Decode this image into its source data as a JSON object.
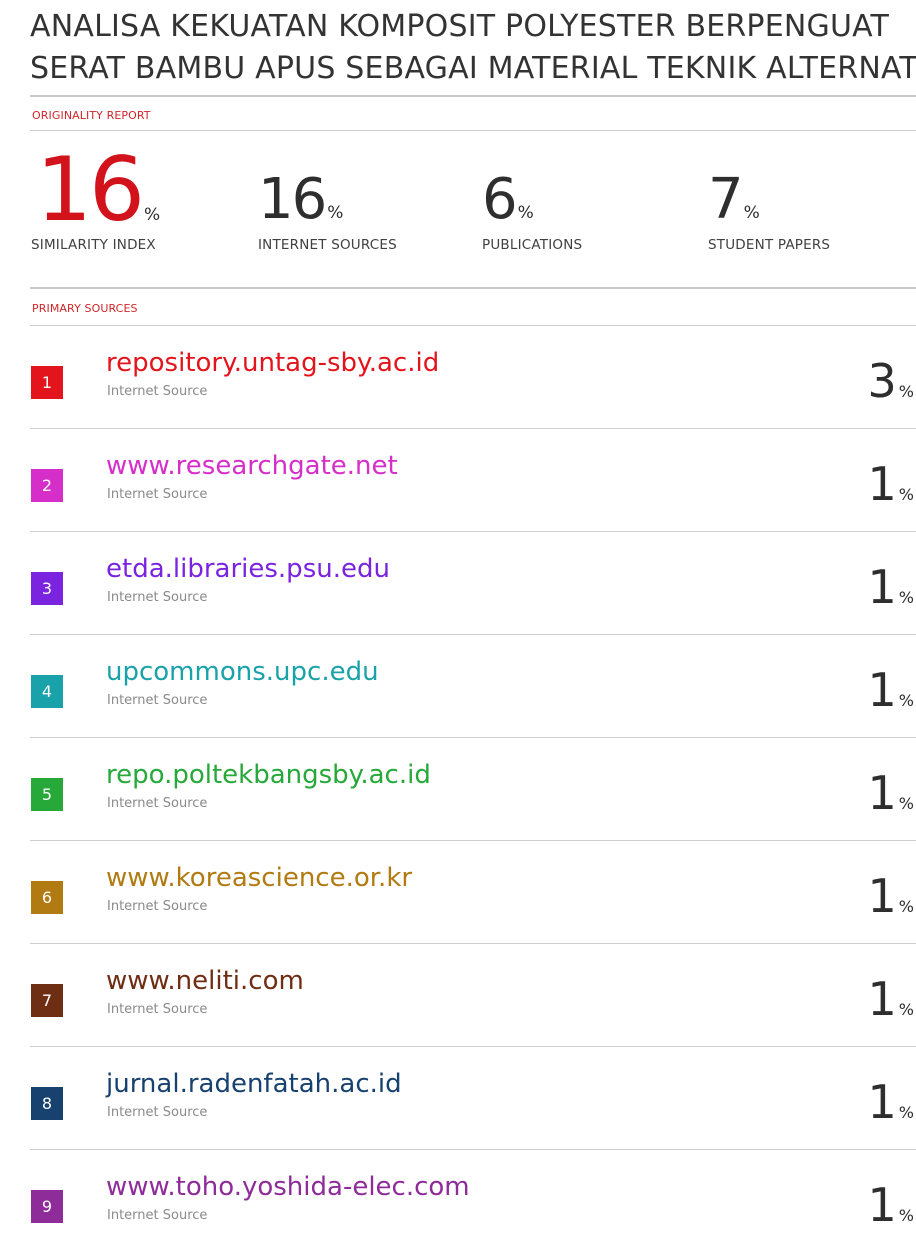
{
  "title": {
    "line1": "ANALISA KEKUATAN KOMPOSIT POLYESTER BERPENGUAT",
    "line2": "SERAT BAMBU APUS SEBAGAI MATERIAL TEKNIK ALTERNATIF"
  },
  "report": {
    "section_label": "ORIGINALITY REPORT",
    "stats": [
      {
        "value": "16",
        "unit": "%",
        "label": "SIMILARITY INDEX"
      },
      {
        "value": "16",
        "unit": "%",
        "label": "INTERNET SOURCES"
      },
      {
        "value": "6",
        "unit": "%",
        "label": "PUBLICATIONS"
      },
      {
        "value": "7",
        "unit": "%",
        "label": "STUDENT PAPERS"
      }
    ]
  },
  "sources_section_label": "PRIMARY SOURCES",
  "sources": [
    {
      "rank": "1",
      "name": "repository.untag-sby.ac.id",
      "type": "Internet Source",
      "value": "3",
      "unit": "%",
      "color": "#e3141c"
    },
    {
      "rank": "2",
      "name": "www.researchgate.net",
      "type": "Internet Source",
      "value": "1",
      "unit": "%",
      "color": "#d62ec9"
    },
    {
      "rank": "3",
      "name": "etda.libraries.psu.edu",
      "type": "Internet Source",
      "value": "1",
      "unit": "%",
      "color": "#7b24e0"
    },
    {
      "rank": "4",
      "name": "upcommons.upc.edu",
      "type": "Internet Source",
      "value": "1",
      "unit": "%",
      "color": "#1aa2ab"
    },
    {
      "rank": "5",
      "name": "repo.poltekbangsby.ac.id",
      "type": "Internet Source",
      "value": "1",
      "unit": "%",
      "color": "#27a93a"
    },
    {
      "rank": "6",
      "name": "www.koreascience.or.kr",
      "type": "Internet Source",
      "value": "1",
      "unit": "%",
      "color": "#b17b12"
    },
    {
      "rank": "7",
      "name": "www.neliti.com",
      "type": "Internet Source",
      "value": "1",
      "unit": "%",
      "color": "#6e2e14"
    },
    {
      "rank": "8",
      "name": "jurnal.radenfatah.ac.id",
      "type": "Internet Source",
      "value": "1",
      "unit": "%",
      "color": "#17416e"
    },
    {
      "rank": "9",
      "name": "www.toho.yoshida-elec.com",
      "type": "Internet Source",
      "value": "1",
      "unit": "%",
      "color": "#8e2c9a"
    }
  ]
}
